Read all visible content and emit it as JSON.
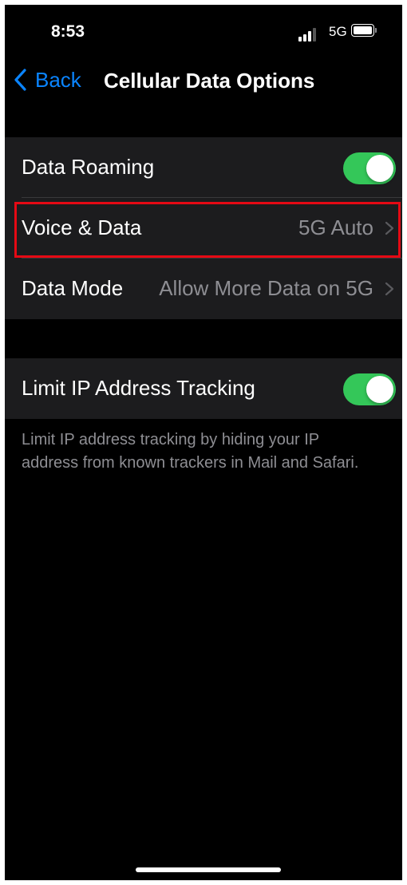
{
  "status_bar": {
    "time": "8:53",
    "network": "5G"
  },
  "nav": {
    "back_label": "Back",
    "title": "Cellular Data Options"
  },
  "cellular_group": {
    "data_roaming": {
      "label": "Data Roaming",
      "enabled": true
    },
    "voice_data": {
      "label": "Voice & Data",
      "value": "5G Auto"
    },
    "data_mode": {
      "label": "Data Mode",
      "value": "Allow More Data on 5G"
    }
  },
  "privacy_group": {
    "limit_ip": {
      "label": "Limit IP Address Tracking",
      "enabled": true
    },
    "footer": "Limit IP address tracking by hiding your IP address from known trackers in Mail and Safari."
  },
  "colors": {
    "accent": "#0a84ff",
    "toggle_on": "#34c759",
    "highlight": "#e50914",
    "cell_bg": "#1c1c1e"
  }
}
